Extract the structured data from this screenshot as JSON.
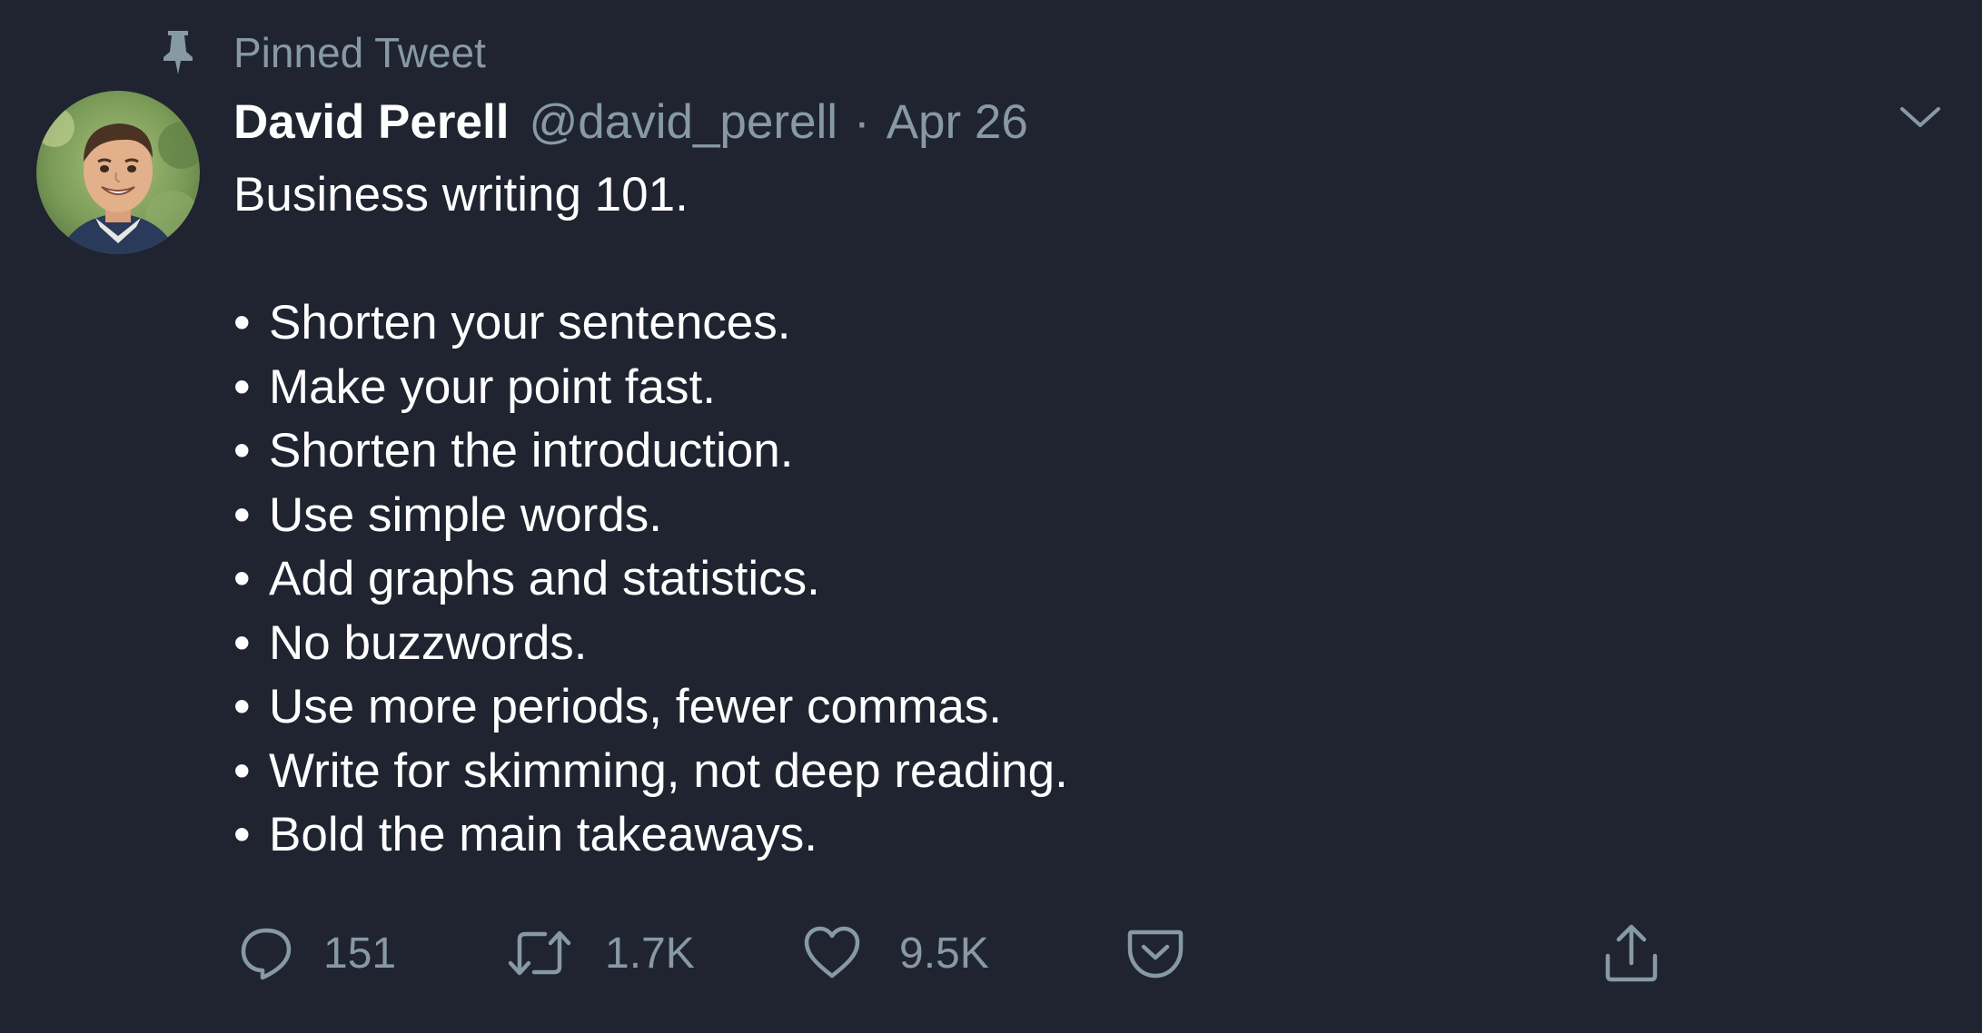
{
  "pinned": {
    "label": "Pinned Tweet",
    "icon": "pin-icon"
  },
  "author": {
    "display_name": "David Perell",
    "handle": "@david_perell",
    "separator": "·",
    "date": "Apr 26"
  },
  "tweet": {
    "intro": "Business writing 101.",
    "bullets": [
      "Shorten your sentences.",
      "Make your point fast.",
      "Shorten the introduction.",
      "Use simple words.",
      "Add graphs and statistics.",
      "No buzzwords.",
      "Use more periods, fewer commas.",
      "Write for skimming, not deep reading.",
      "Bold the main takeaways."
    ]
  },
  "actions": {
    "reply": {
      "count": "151",
      "icon": "reply-icon"
    },
    "retweet": {
      "count": "1.7K",
      "icon": "retweet-icon"
    },
    "like": {
      "count": "9.5K",
      "icon": "heart-icon"
    },
    "save": {
      "icon": "pocket-icon"
    },
    "share": {
      "icon": "share-icon"
    }
  },
  "colors": {
    "background": "#1f2430",
    "primary_text": "#ffffff",
    "secondary_text": "#8899a6"
  }
}
